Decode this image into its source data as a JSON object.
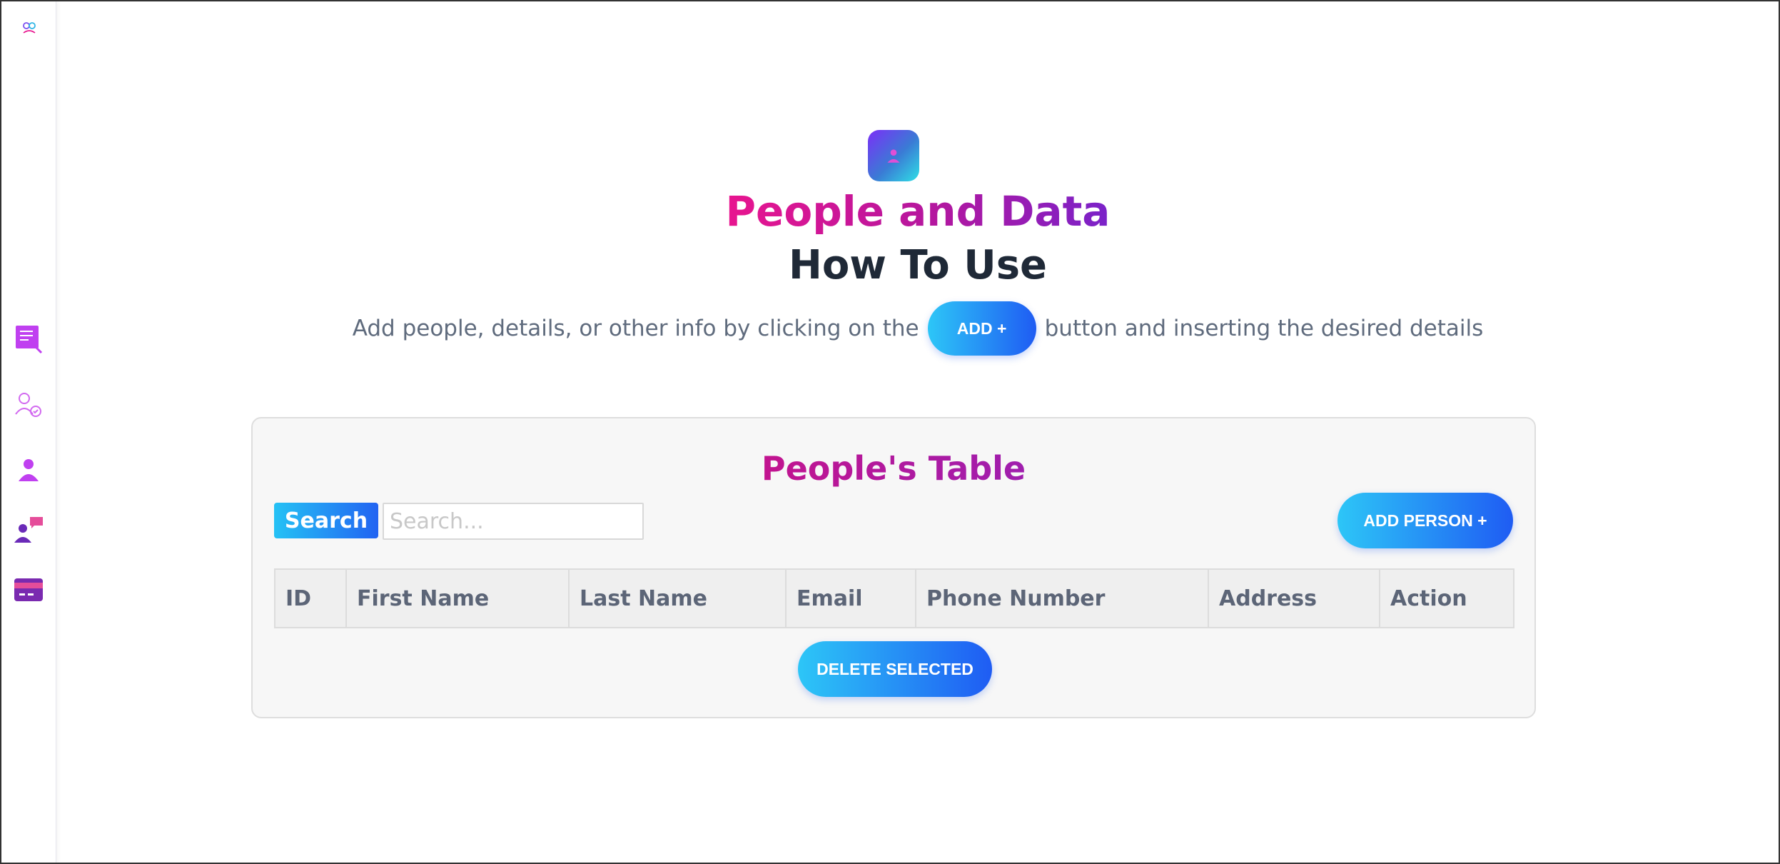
{
  "sidebar": {
    "items": [
      {
        "name": "document-edit",
        "color": "#c040f0"
      },
      {
        "name": "team-users",
        "color": "#d26af0"
      },
      {
        "name": "person",
        "color": "#c040f0"
      },
      {
        "name": "person-chat",
        "color": "#6a2ab8"
      },
      {
        "name": "card",
        "color": "#7a2ab0"
      }
    ]
  },
  "hero": {
    "title": "People and Data",
    "subtitle": "How To Use",
    "desc_before": "Add people, details, or other info by clicking on the",
    "add_label": "ADD +",
    "desc_after": "button and inserting the desired details"
  },
  "table_card": {
    "title": "People's Table",
    "search_label": "Search",
    "search_placeholder": "Search...",
    "add_person_label": "ADD PERSON +",
    "columns": [
      "ID",
      "First Name",
      "Last Name",
      "Email",
      "Phone Number",
      "Address",
      "Action"
    ],
    "delete_label": "DELETE SELECTED"
  },
  "colors": {
    "accent_gradient_start": "#2dc6f7",
    "accent_gradient_end": "#1f5cf3",
    "title_pink": "#e8158f",
    "title_purple": "#7a22c9"
  }
}
